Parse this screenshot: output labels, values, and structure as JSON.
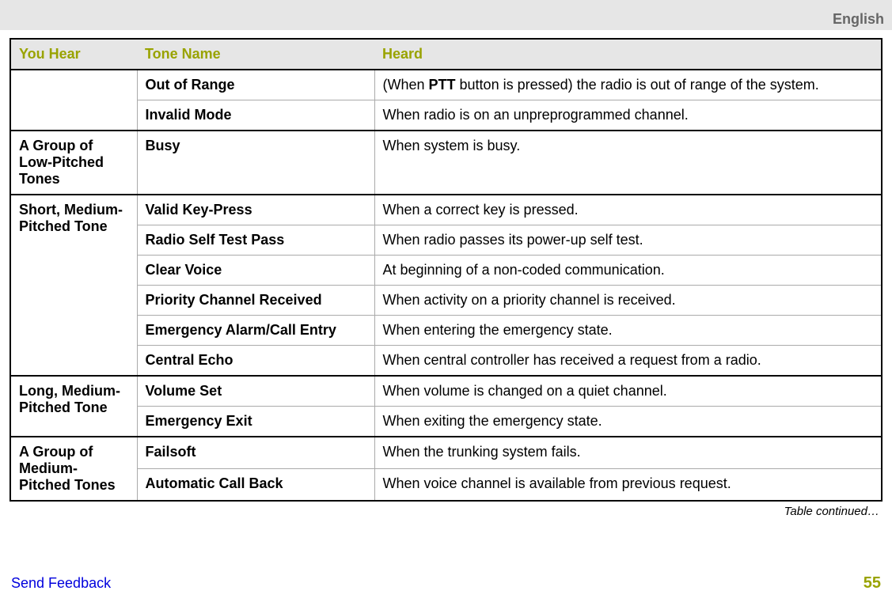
{
  "header": {
    "language": "English"
  },
  "table": {
    "columns": [
      "You Hear",
      "Tone Name",
      "Heard"
    ],
    "groups": [
      {
        "you_hear": "",
        "rows": [
          {
            "tone_name": "Out of Range",
            "heard_pre": "(When ",
            "heard_bold": "PTT",
            "heard_post": " button is pressed) the radio is out of range of the system."
          },
          {
            "tone_name": "Invalid Mode",
            "heard": "When radio is on an unpreprogrammed channel."
          }
        ]
      },
      {
        "you_hear": "A Group of Low-Pitched Tones",
        "rows": [
          {
            "tone_name": "Busy",
            "heard": "When system is busy."
          }
        ]
      },
      {
        "you_hear": "Short, Medium-Pitched Tone",
        "rows": [
          {
            "tone_name": "Valid Key-Press",
            "heard": "When a correct key is pressed."
          },
          {
            "tone_name": "Radio Self Test Pass",
            "heard": "When radio passes its power-up self test."
          },
          {
            "tone_name": "Clear Voice",
            "heard": "At beginning of a non-coded communication."
          },
          {
            "tone_name": "Priority Channel Received",
            "heard": "When activity on a priority channel is received."
          },
          {
            "tone_name": "Emergency Alarm/Call Entry",
            "heard": "When entering the emergency state."
          },
          {
            "tone_name": "Central Echo",
            "heard": "When central controller has received a request from a radio."
          }
        ]
      },
      {
        "you_hear": "Long, Medium-Pitched Tone",
        "rows": [
          {
            "tone_name": "Volume Set",
            "heard": "When volume is changed on a quiet channel."
          },
          {
            "tone_name": "Emergency Exit",
            "heard": "When exiting the emergency state."
          }
        ]
      },
      {
        "you_hear": "A Group of Medium-Pitched Tones",
        "rows": [
          {
            "tone_name": "Failsoft",
            "heard": "When the trunking system fails."
          },
          {
            "tone_name": "Automatic Call Back",
            "heard": "When voice channel is available from previous request."
          }
        ]
      }
    ],
    "continued": "Table continued…"
  },
  "footer": {
    "feedback": "Send Feedback",
    "page": "55"
  }
}
